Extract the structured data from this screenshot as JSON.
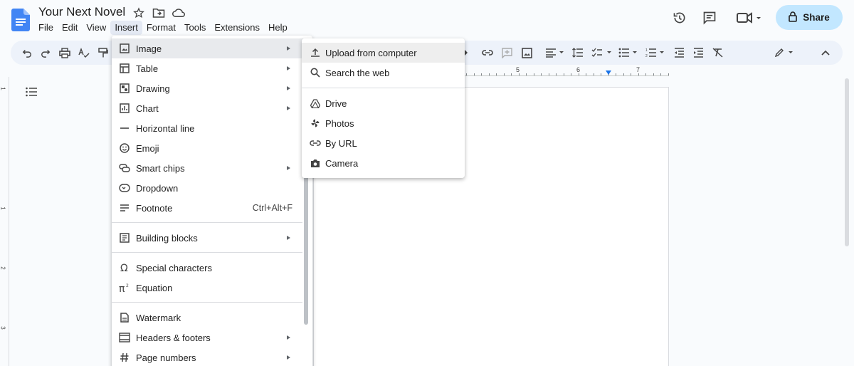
{
  "document": {
    "title": "Your Next Novel"
  },
  "menubar": {
    "items": [
      "File",
      "Edit",
      "View",
      "Insert",
      "Format",
      "Tools",
      "Extensions",
      "Help"
    ],
    "active": "Insert"
  },
  "header": {
    "share_label": "Share"
  },
  "ruler": {
    "numbers": [
      "5",
      "6",
      "7"
    ]
  },
  "vruler": {
    "numbers": [
      "1",
      "1",
      "2",
      "3"
    ]
  },
  "insert_menu": {
    "items": [
      {
        "label": "Image",
        "icon": "image-icon",
        "submenu": true,
        "highlighted": true
      },
      {
        "label": "Table",
        "icon": "table-icon",
        "submenu": true
      },
      {
        "label": "Drawing",
        "icon": "drawing-icon",
        "submenu": true
      },
      {
        "label": "Chart",
        "icon": "chart-icon",
        "submenu": true
      },
      {
        "label": "Horizontal line",
        "icon": "horizontal-line-icon"
      },
      {
        "label": "Emoji",
        "icon": "emoji-icon"
      },
      {
        "label": "Smart chips",
        "icon": "smart-chips-icon",
        "submenu": true
      },
      {
        "label": "Dropdown",
        "icon": "dropdown-icon"
      },
      {
        "label": "Footnote",
        "icon": "footnote-icon",
        "shortcut": "Ctrl+Alt+F"
      },
      {
        "label": "Building blocks",
        "icon": "building-blocks-icon",
        "submenu": true
      },
      {
        "label": "Special characters",
        "icon": "omega-icon"
      },
      {
        "label": "Equation",
        "icon": "pi-icon"
      },
      {
        "label": "Watermark",
        "icon": "watermark-icon"
      },
      {
        "label": "Headers & footers",
        "icon": "headers-footers-icon",
        "submenu": true
      },
      {
        "label": "Page numbers",
        "icon": "hash-icon",
        "submenu": true
      }
    ]
  },
  "image_submenu": {
    "items": [
      {
        "label": "Upload from computer",
        "icon": "upload-icon",
        "highlighted": true
      },
      {
        "label": "Search the web",
        "icon": "search-icon"
      },
      {
        "label": "Drive",
        "icon": "drive-icon"
      },
      {
        "label": "Photos",
        "icon": "photos-icon"
      },
      {
        "label": "By URL",
        "icon": "link-icon"
      },
      {
        "label": "Camera",
        "icon": "camera-icon"
      }
    ]
  },
  "colors": {
    "accent": "#1a73e8",
    "share_bg": "#c2e7ff",
    "toolbar_bg": "#edf2fa"
  }
}
